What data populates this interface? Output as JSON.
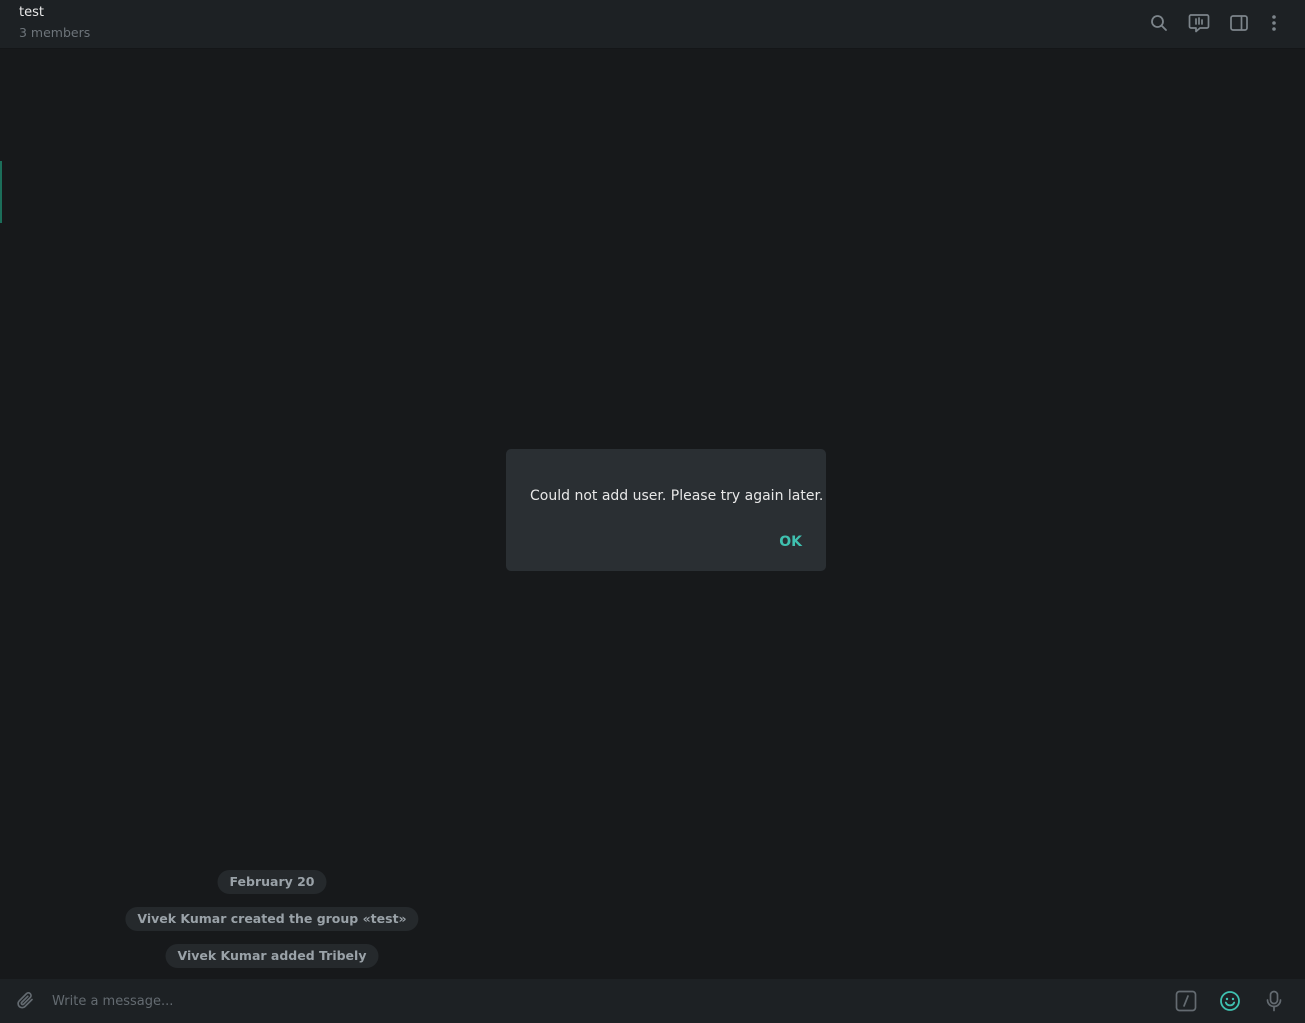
{
  "header": {
    "title": "test",
    "subtitle": "3 members",
    "icons": [
      "search-icon",
      "video-chat-icon",
      "sidebar-toggle-icon",
      "more-vertical-icon"
    ]
  },
  "messages": {
    "date_label": "February 20",
    "service_messages": [
      "Vivek Kumar created the group «test»",
      "Vivek Kumar added Tribely"
    ]
  },
  "dialog": {
    "message": "Could not add user. Please try again later.",
    "ok_label": "OK"
  },
  "composer": {
    "placeholder": "Write a message...",
    "icons": [
      "attach-icon",
      "bot-command-icon",
      "emoji-icon",
      "microphone-icon"
    ]
  },
  "colors": {
    "background": "#17191b",
    "header": "#1d2124",
    "dialog": "#2a2f33",
    "accent": "#3fc1b0",
    "pill": "#25292c"
  }
}
